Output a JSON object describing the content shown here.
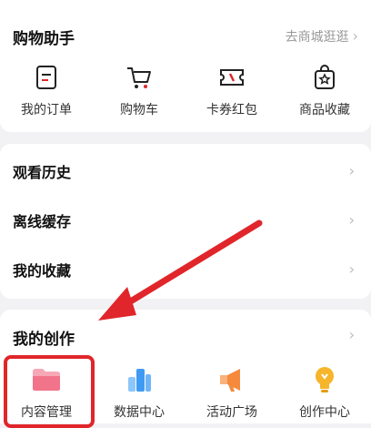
{
  "shopping": {
    "title": "购物助手",
    "link": "去商城逛逛",
    "items": [
      {
        "label": "我的订单",
        "icon": "order-icon"
      },
      {
        "label": "购物车",
        "icon": "cart-icon"
      },
      {
        "label": "卡券红包",
        "icon": "coupon-icon"
      },
      {
        "label": "商品收藏",
        "icon": "favorite-bag-icon"
      }
    ]
  },
  "list": {
    "items": [
      {
        "label": "观看历史"
      },
      {
        "label": "离线缓存"
      },
      {
        "label": "我的收藏"
      }
    ]
  },
  "creation": {
    "title": "我的创作",
    "items": [
      {
        "label": "内容管理",
        "icon": "folder-icon"
      },
      {
        "label": "数据中心",
        "icon": "data-center-icon"
      },
      {
        "label": "活动广场",
        "icon": "megaphone-icon"
      },
      {
        "label": "创作中心",
        "icon": "lightbulb-icon"
      }
    ]
  },
  "colors": {
    "annotation_red": "#e0262a",
    "folder_pink": "#f2748a",
    "data_blue": "#3f9bf2",
    "megaphone_orange": "#f58a3c",
    "bulb_yellow": "#f6b52a"
  }
}
